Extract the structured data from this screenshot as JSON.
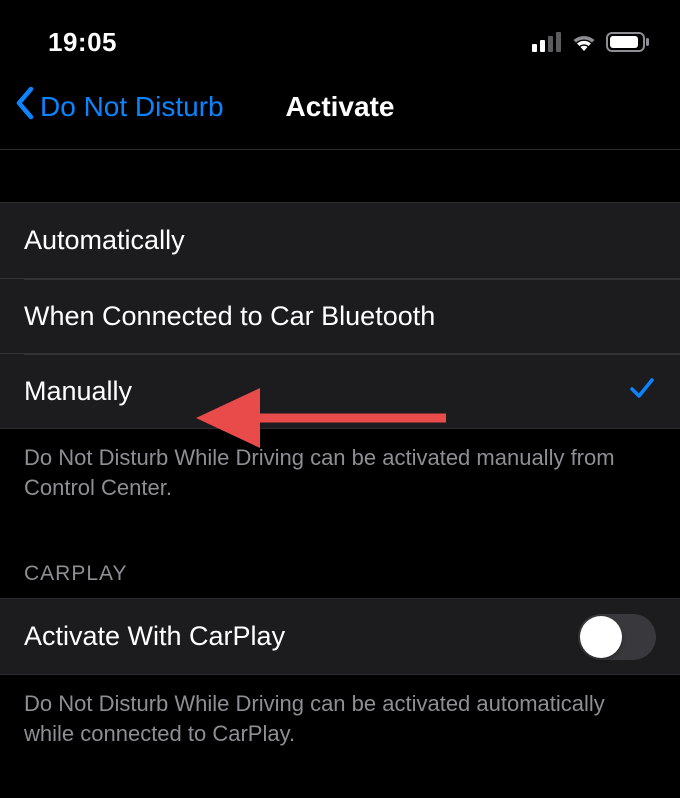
{
  "status": {
    "time": "19:05"
  },
  "nav": {
    "back_label": "Do Not Disturb",
    "title": "Activate"
  },
  "section1": {
    "rows": [
      {
        "label": "Automatically",
        "checked": false
      },
      {
        "label": "When Connected to Car Bluetooth",
        "checked": false
      },
      {
        "label": "Manually",
        "checked": true
      }
    ],
    "footer": "Do Not Disturb While Driving can be activated manually from Control Center."
  },
  "section2": {
    "header": "CARPLAY",
    "rows": [
      {
        "label": "Activate With CarPlay",
        "toggle": false
      }
    ],
    "footer": "Do Not Disturb While Driving can be activated automatically while connected to CarPlay."
  },
  "annotation": {
    "color": "#e94b4a"
  }
}
